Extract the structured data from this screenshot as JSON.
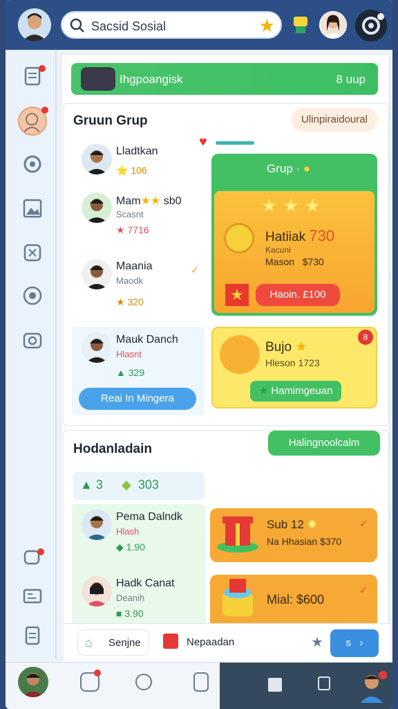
{
  "topbar": {
    "search_text": "Sacsid Sosial"
  },
  "banner": {
    "title": "Ihgpoangisk",
    "right": "8 uup"
  },
  "group": {
    "title": "Gruun Grup",
    "action": "Ulinpiraidoural",
    "members": [
      {
        "name": "Lladtkan",
        "sub": "",
        "value": "106"
      },
      {
        "name": "Mam",
        "name_suffix": "sb0",
        "sub": "Scasnt",
        "value": "7716"
      },
      {
        "name": "Maania",
        "sub": "Maodk",
        "value": "320"
      },
      {
        "name": "Mauk Danch",
        "sub": "Hlasnt",
        "value": "329"
      }
    ],
    "member_button": "Reai In Mingera"
  },
  "grup_card": {
    "header": "Grup",
    "title": "Hatiiak",
    "title_value": "730",
    "sub": "Kacuni",
    "line": "Mason",
    "line_value": "$730",
    "button": "Haoin. ",
    "button_value": "£100"
  },
  "bujo_card": {
    "title": "Bujo",
    "sub": "Hleson",
    "sub_value": "1723",
    "badge": "8",
    "button": "Hamimgeuan"
  },
  "section2": {
    "title": "Hodanladain",
    "action": "Halingnoolcalm",
    "summary_left": "3",
    "summary_value": "303",
    "members": [
      {
        "name": "Pema Dalndk",
        "sub": "Hlash",
        "value": "1.90"
      },
      {
        "name": "Hadk Canat",
        "sub": "Deanih",
        "value": "3.90"
      }
    ]
  },
  "offers": [
    {
      "title": "Sub 12",
      "sub": "Na Hhasian",
      "value": "$370"
    },
    {
      "title": "Mial: $600",
      "sub": "",
      "value": ""
    }
  ],
  "footer_bar": {
    "left_label": "Senjne",
    "right_label": "Nepaadan"
  },
  "colors": {
    "topbar": "#2d4f87",
    "green": "#43c063",
    "orange": "#f7a935",
    "yellow": "#fde86a",
    "red": "#ef4a3d",
    "blue": "#3a8fe0"
  }
}
